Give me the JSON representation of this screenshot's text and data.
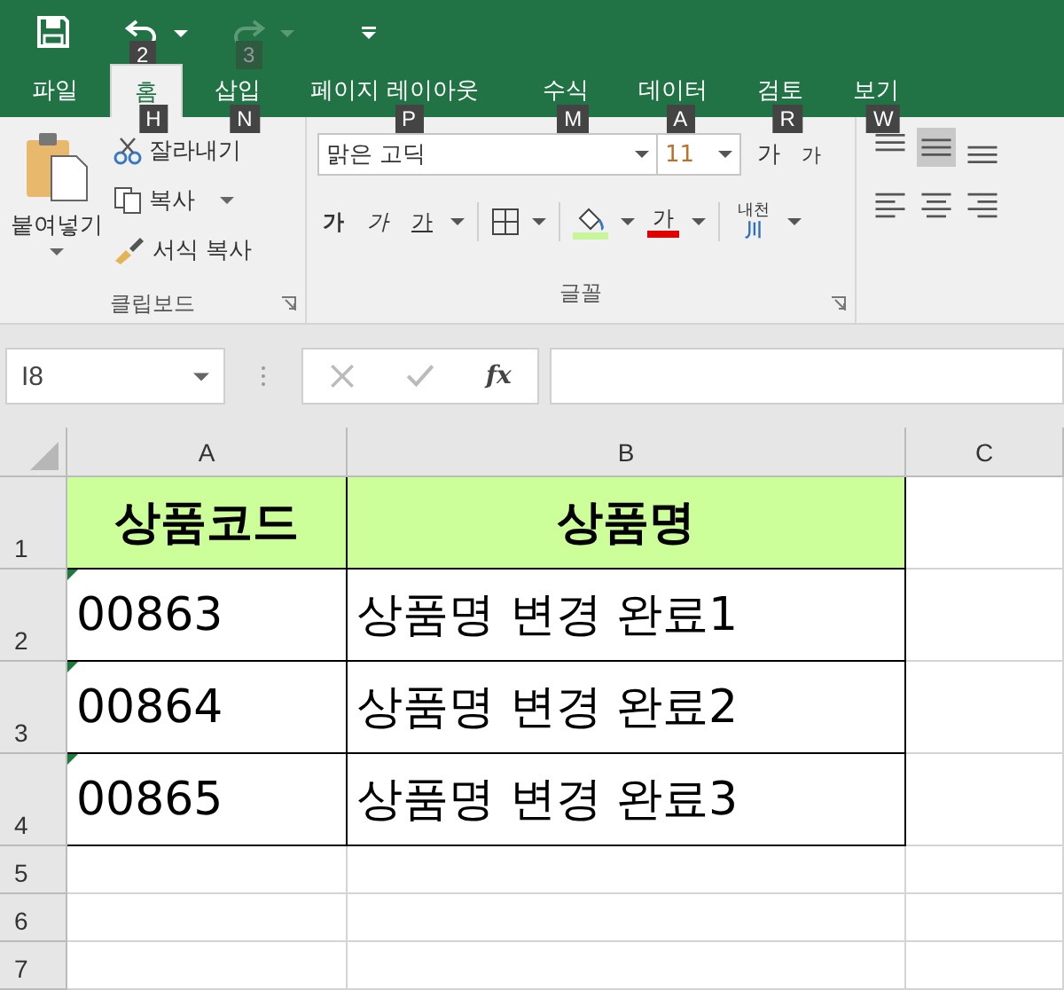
{
  "qat": {
    "undo_keytip": "2",
    "redo_keytip": "3"
  },
  "tabs": [
    {
      "label": "파일",
      "selected": false
    },
    {
      "label": "홈",
      "selected": true,
      "keytip": "H"
    },
    {
      "label": "삽입",
      "selected": false,
      "keytip": "N"
    },
    {
      "label": "페이지 레이아웃",
      "selected": false,
      "keytip": "P"
    },
    {
      "label": "수식",
      "selected": false,
      "keytip": "M"
    },
    {
      "label": "데이터",
      "selected": false,
      "keytip": "A"
    },
    {
      "label": "검토",
      "selected": false,
      "keytip": "R"
    },
    {
      "label": "보기",
      "selected": false,
      "keytip": "W"
    }
  ],
  "clipboard": {
    "paste": "붙여넣기",
    "cut": "잘라내기",
    "copy": "복사",
    "format_painter": "서식 복사",
    "label": "클립보드"
  },
  "font": {
    "name": "맑은 고딕",
    "size": "11",
    "grow": "가",
    "shrink": "가",
    "bold": "가",
    "italic": "가",
    "underline": "가",
    "font_color": "가",
    "phonetic": "내천",
    "phonetic_mark": "川",
    "label": "글꼴"
  },
  "formula_bar": {
    "name_box": "I8",
    "fx": "fx"
  },
  "columns": [
    {
      "label": "A"
    },
    {
      "label": "B"
    },
    {
      "label": "C"
    }
  ],
  "rows": [
    {
      "number": "1",
      "header": true,
      "cells": [
        "상품코드",
        "상품명",
        ""
      ],
      "flag": false
    },
    {
      "number": "2",
      "header": false,
      "cells": [
        "00863",
        "상품명 변경 완료1",
        ""
      ],
      "flag": true
    },
    {
      "number": "3",
      "header": false,
      "cells": [
        "00864",
        "상품명 변경 완료2",
        ""
      ],
      "flag": true
    },
    {
      "number": "4",
      "header": false,
      "cells": [
        "00865",
        "상품명 변경 완료3",
        ""
      ],
      "flag": true
    },
    {
      "number": "5",
      "header": false,
      "cells": [
        "",
        "",
        ""
      ],
      "flag": false
    },
    {
      "number": "6",
      "header": false,
      "cells": [
        "",
        "",
        ""
      ],
      "flag": false
    },
    {
      "number": "7",
      "header": false,
      "cells": [
        "",
        "",
        ""
      ],
      "flag": false
    }
  ]
}
